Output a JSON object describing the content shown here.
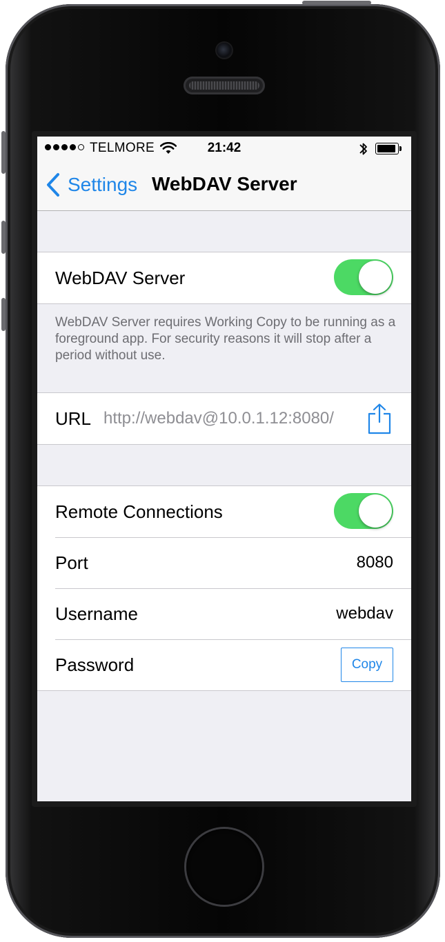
{
  "status_bar": {
    "carrier": "TELMORE",
    "time": "21:42",
    "signal_bars": 4,
    "signal_total": 5
  },
  "nav": {
    "back_label": "Settings",
    "title": "WebDAV Server"
  },
  "server_section": {
    "toggle_label": "WebDAV Server",
    "toggle_on": true,
    "footer_note": "WebDAV Server requires Working Copy to be running as a foreground app. For security reasons it will stop after a period without use."
  },
  "url_section": {
    "label": "URL",
    "value": "http://webdav@10.0.1.12:8080/"
  },
  "remote_section": {
    "remote_label": "Remote Connections",
    "remote_on": true,
    "port_label": "Port",
    "port_value": "8080",
    "username_label": "Username",
    "username_value": "webdav",
    "password_label": "Password",
    "copy_label": "Copy"
  },
  "colors": {
    "accent": "#1f86e8",
    "toggle_on": "#4cd964",
    "background": "#efeff4"
  },
  "icons": [
    "wifi-icon",
    "bluetooth-icon",
    "battery-icon",
    "back-chevron-icon",
    "share-icon"
  ]
}
